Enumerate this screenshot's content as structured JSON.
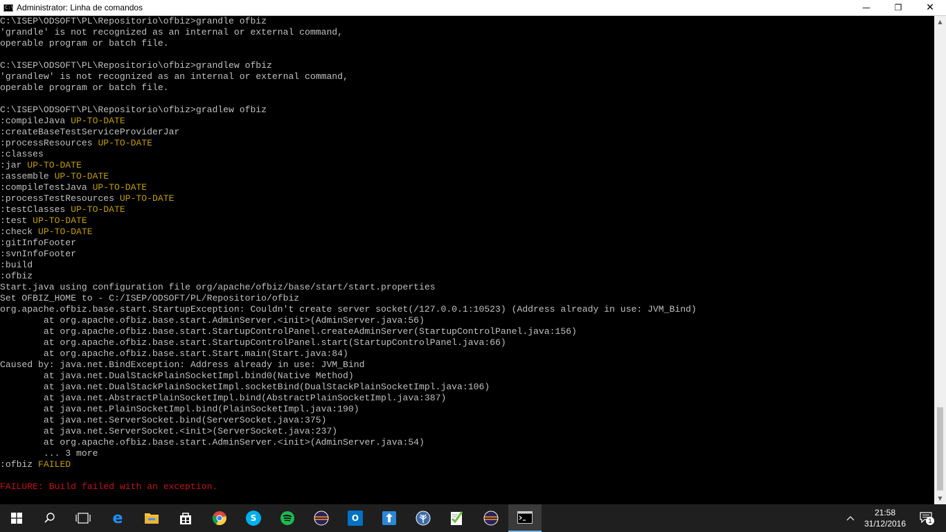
{
  "window": {
    "title": "Administrator: Linha de comandos",
    "icon_text": "C:\\",
    "minimize": "—",
    "maximize": "❐",
    "close": "✕"
  },
  "console": {
    "lines": [
      {
        "text": "C:\\ISEP\\ODSOFT\\PL\\Repositorio\\ofbiz>grandle ofbiz"
      },
      {
        "text": "'grandle' is not recognized as an internal or external command,"
      },
      {
        "text": "operable program or batch file."
      },
      {
        "text": ""
      },
      {
        "text": "C:\\ISEP\\ODSOFT\\PL\\Repositorio\\ofbiz>grandlew ofbiz"
      },
      {
        "text": "'grandlew' is not recognized as an internal or external command,"
      },
      {
        "text": "operable program or batch file."
      },
      {
        "text": ""
      },
      {
        "text": "C:\\ISEP\\ODSOFT\\PL\\Repositorio\\ofbiz>gradlew ofbiz"
      },
      {
        "text": ":compileJava ",
        "status": "UP-TO-DATE"
      },
      {
        "text": ":createBaseTestServiceProviderJar"
      },
      {
        "text": ":processResources ",
        "status": "UP-TO-DATE"
      },
      {
        "text": ":classes"
      },
      {
        "text": ":jar ",
        "status": "UP-TO-DATE"
      },
      {
        "text": ":assemble ",
        "status": "UP-TO-DATE"
      },
      {
        "text": ":compileTestJava ",
        "status": "UP-TO-DATE"
      },
      {
        "text": ":processTestResources ",
        "status": "UP-TO-DATE"
      },
      {
        "text": ":testClasses ",
        "status": "UP-TO-DATE"
      },
      {
        "text": ":test ",
        "status": "UP-TO-DATE"
      },
      {
        "text": ":check ",
        "status": "UP-TO-DATE"
      },
      {
        "text": ":gitInfoFooter"
      },
      {
        "text": ":svnInfoFooter"
      },
      {
        "text": ":build"
      },
      {
        "text": ":ofbiz"
      },
      {
        "text": "Start.java using configuration file org/apache/ofbiz/base/start/start.properties"
      },
      {
        "text": "Set OFBIZ_HOME to - C:/ISEP/ODSOFT/PL/Repositorio/ofbiz"
      },
      {
        "text": "org.apache.ofbiz.base.start.StartupException: Couldn't create server socket(/127.0.0.1:10523) (Address already in use: JVM_Bind)"
      },
      {
        "text": "        at org.apache.ofbiz.base.start.AdminServer.<init>(AdminServer.java:56)"
      },
      {
        "text": "        at org.apache.ofbiz.base.start.StartupControlPanel.createAdminServer(StartupControlPanel.java:156)"
      },
      {
        "text": "        at org.apache.ofbiz.base.start.StartupControlPanel.start(StartupControlPanel.java:66)"
      },
      {
        "text": "        at org.apache.ofbiz.base.start.Start.main(Start.java:84)"
      },
      {
        "text": "Caused by: java.net.BindException: Address already in use: JVM_Bind"
      },
      {
        "text": "        at java.net.DualStackPlainSocketImpl.bind0(Native Method)"
      },
      {
        "text": "        at java.net.DualStackPlainSocketImpl.socketBind(DualStackPlainSocketImpl.java:106)"
      },
      {
        "text": "        at java.net.AbstractPlainSocketImpl.bind(AbstractPlainSocketImpl.java:387)"
      },
      {
        "text": "        at java.net.PlainSocketImpl.bind(PlainSocketImpl.java:190)"
      },
      {
        "text": "        at java.net.ServerSocket.bind(ServerSocket.java:375)"
      },
      {
        "text": "        at java.net.ServerSocket.<init>(ServerSocket.java:237)"
      },
      {
        "text": "        at org.apache.ofbiz.base.start.AdminServer.<init>(AdminServer.java:54)"
      },
      {
        "text": "        ... 3 more"
      },
      {
        "text": ":ofbiz ",
        "status": "FAILED"
      },
      {
        "text": ""
      },
      {
        "text": "",
        "error": "FAILURE: Build failed with an exception."
      }
    ]
  },
  "colors": {
    "status_yellow": "#c19c00",
    "error_red": "#c50f1f",
    "console_text": "#c0c0c0",
    "taskbar_bg": "#1f1f1f",
    "active_underline": "#76b9ed"
  },
  "taskbar": {
    "items": [
      {
        "name": "start-button",
        "icon": "windows-logo-icon",
        "glyph": "",
        "color": "#ffffff",
        "interactable": true
      },
      {
        "name": "search-button",
        "icon": "search-icon",
        "glyph": "",
        "color": "#ffffff"
      },
      {
        "name": "task-view-button",
        "icon": "task-view-icon",
        "glyph": "",
        "color": "#ffffff"
      },
      {
        "name": "taskbar-edge",
        "icon": "edge-icon",
        "glyph": "e",
        "color": "#1e90ff"
      },
      {
        "name": "taskbar-file-explorer",
        "icon": "folder-icon",
        "glyph": "",
        "color": "#f5c542"
      },
      {
        "name": "taskbar-store",
        "icon": "store-icon",
        "glyph": "",
        "color": "#3a7bd5"
      },
      {
        "name": "taskbar-chrome",
        "icon": "chrome-icon",
        "glyph": "",
        "color": "#dd4b39"
      },
      {
        "name": "taskbar-skype",
        "icon": "skype-icon",
        "glyph": "S",
        "color": "#00aff0"
      },
      {
        "name": "taskbar-spotify",
        "icon": "spotify-icon",
        "glyph": "",
        "color": "#1db954"
      },
      {
        "name": "taskbar-eclipse",
        "icon": "eclipse-icon",
        "glyph": "",
        "color": "#2c2255"
      },
      {
        "name": "taskbar-outlook",
        "icon": "outlook-icon",
        "glyph": "O",
        "color": "#0072c6"
      },
      {
        "name": "taskbar-upload-app",
        "icon": "upload-icon",
        "glyph": "",
        "color": "#2b88d8"
      },
      {
        "name": "taskbar-sourcetree",
        "icon": "sourcetree-icon",
        "glyph": "",
        "color": "#3d6ba8"
      },
      {
        "name": "taskbar-notepadpp",
        "icon": "notepad-plus-plus-icon",
        "glyph": "",
        "color": "#8bc34a"
      },
      {
        "name": "taskbar-eclipse-2",
        "icon": "eclipse-icon",
        "glyph": "",
        "color": "#2c2255"
      },
      {
        "name": "taskbar-cmd",
        "icon": "command-prompt-icon",
        "glyph": "C:\\",
        "color": "#000000",
        "active": true
      }
    ],
    "tray": {
      "chevron": "^",
      "time": "21:58",
      "date": "31/12/2016",
      "notification_count": "1"
    }
  }
}
